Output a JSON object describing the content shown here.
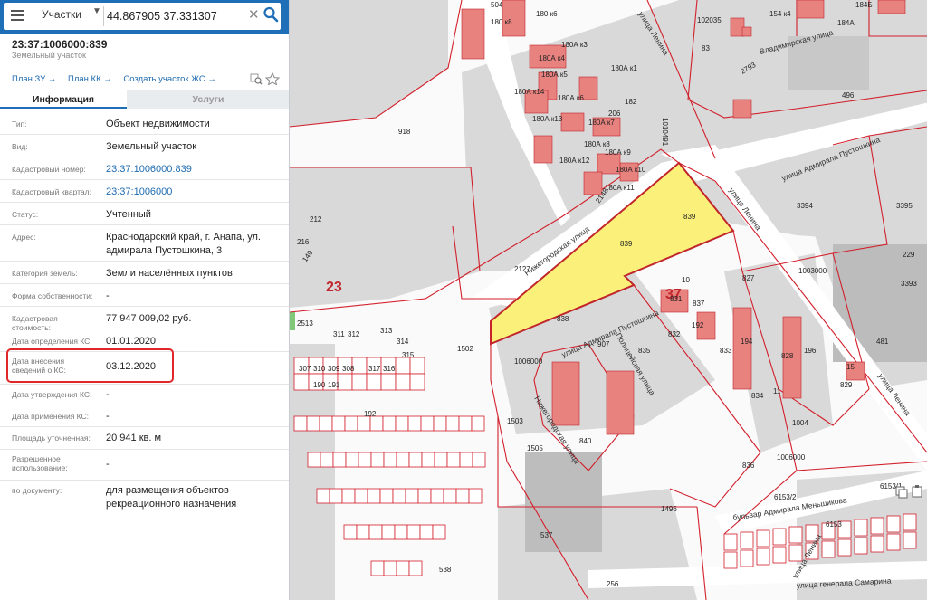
{
  "search": {
    "type_label": "Участки",
    "query": "44.867905 37.331307"
  },
  "object": {
    "cad_number": "23:37:1006000:839",
    "subtitle": "Земельный участок"
  },
  "links": [
    "План ЗУ →",
    "План КК →",
    "Создать участок ЖС →"
  ],
  "tabs": {
    "info": "Информация",
    "services": "Услуги"
  },
  "rows": [
    {
      "label": "Тип:",
      "value": "Объект недвижимости"
    },
    {
      "label": "Вид:",
      "value": "Земельный участок"
    },
    {
      "label": "Кадастровый номер:",
      "value": "23:37:1006000:839"
    },
    {
      "label": "Кадастровый квартал:",
      "value": "23:37:1006000"
    },
    {
      "label": "Статус:",
      "value": "Учтенный"
    },
    {
      "label": "Адрес:",
      "value": "Краснодарский край, г. Анапа, ул. адмирала Пустошкина, 3"
    },
    {
      "label": "Категория земель:",
      "value": "Земли населённых пунктов"
    },
    {
      "label": "Форма собственности:",
      "value": "-"
    },
    {
      "label": "Кадастровая стоимость:",
      "value": "77 947 009,02 руб."
    },
    {
      "label": "Дата определения КС:",
      "value": "01.01.2020"
    },
    {
      "label": "Дата внесения сведений о КС:",
      "value": "03.12.2020"
    },
    {
      "label": "Дата утверждения КС:",
      "value": "-"
    },
    {
      "label": "Дата применения КС:",
      "value": "-"
    },
    {
      "label": "Площадь уточненная:",
      "value": "20 941 кв. м"
    },
    {
      "label": "Разрешенное использование:",
      "value": "-"
    },
    {
      "label": "по документу:",
      "value": "для размещения объектов рекреационного назначения"
    }
  ],
  "map": {
    "quarter_labels": [
      "23",
      "37"
    ],
    "streets": [
      "Нижегородская улица",
      "улица Адмирала Пустошкина",
      "улица Ленина",
      "Владимирская улица",
      "улица Адмирала Пустошкина",
      "Полицейская улица",
      "бульвар Адмирала Меньшикова",
      "улица генерала Самарина",
      "улица Ленина",
      "Нижегородская улица",
      "улица Ленина",
      "улица Ленина"
    ],
    "parcels": [
      "839",
      "839",
      "838",
      "840",
      "835",
      "836",
      "837",
      "827",
      "831",
      "832",
      "833",
      "834",
      "828",
      "829",
      "192",
      "194",
      "196",
      "1502",
      "1503",
      "1505",
      "1004",
      "1003000",
      "1006000",
      "1006000",
      "1010491",
      "918",
      "1496",
      "537",
      "538",
      "256",
      "481",
      "229",
      "3393",
      "3394",
      "3395",
      "2513",
      "2127",
      "2148",
      "2793",
      "496",
      "102035",
      "83",
      "180А к1",
      "180А к3",
      "180А к4",
      "180А к5",
      "180А к6",
      "180А к7",
      "180А к8",
      "180А к9",
      "180А к10",
      "180А к11",
      "180А к12",
      "180А к13",
      "180А к14",
      "180 к6",
      "180 к8",
      "504",
      "182",
      "206",
      "154 к4",
      "184А",
      "184Б",
      "907",
      "15",
      "11",
      "10",
      "311",
      "312",
      "313",
      "314",
      "315",
      "316",
      "317",
      "310",
      "309",
      "308",
      "307",
      "190",
      "191",
      "192",
      "212",
      "216",
      "149",
      "6153",
      "6153/1",
      "6153/2"
    ],
    "colors": {
      "selected_fill": "#fbf17a",
      "boundary": "#d21f2b",
      "building": "#e8827f"
    }
  }
}
